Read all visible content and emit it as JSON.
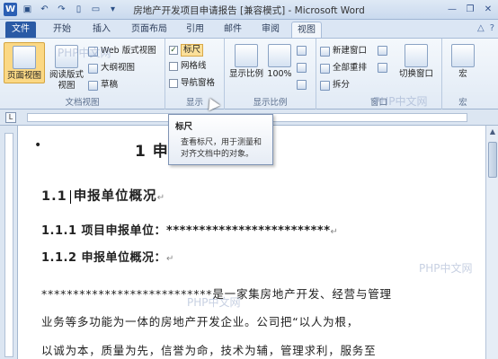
{
  "window": {
    "title": "房地产开发项目申请报告 [兼容模式] - Microsoft Word",
    "qat_icons": [
      "word-logo",
      "save-icon",
      "undo-icon",
      "redo-icon",
      "new-doc-icon",
      "open-icon",
      "customize-qat-icon"
    ],
    "controls": [
      "minimize-icon",
      "restore-icon",
      "close-icon"
    ]
  },
  "tabs": [
    {
      "label": "文件",
      "type": "file"
    },
    {
      "label": "开始"
    },
    {
      "label": "插入"
    },
    {
      "label": "页面布局"
    },
    {
      "label": "引用"
    },
    {
      "label": "邮件"
    },
    {
      "label": "审阅"
    },
    {
      "label": "视图",
      "active": true
    }
  ],
  "ribbon": {
    "views_group": {
      "label": "文档视图",
      "print_layout": "页面视图",
      "read_mode": "阅读版式\n视图",
      "web_layout": "Web 版式视图",
      "outline": "大纲视图",
      "draft": "草稿"
    },
    "show_group": {
      "label": "显示",
      "ruler": "标尺",
      "ruler_checked": true,
      "gridlines": "网格线",
      "gridlines_checked": false,
      "nav_pane": "导航窗格",
      "nav_pane_checked": false
    },
    "zoom_group": {
      "label": "显示比例",
      "zoom": "显示比例",
      "hundred": "100%"
    },
    "window_group": {
      "label": "窗口",
      "new_window": "新建窗口",
      "arrange_all": "全部重排",
      "split": "拆分",
      "switch_windows": "切换窗口"
    },
    "macros_group": {
      "label": "宏",
      "macros": "宏"
    }
  },
  "tooltip": {
    "title": "标尺",
    "body_line1": "查看标尺，用于测量和",
    "body_line2": "对齐文档中的对象。"
  },
  "document": {
    "title": "1  申报单位概况",
    "title_visible_suffix": "目概况",
    "h1_number": "1.1",
    "h1_text": "申报单位概况",
    "h2a": "1.1.1 项目申报单位：*************************",
    "h2b": "1.1.2 申报单位概况：",
    "para_line1": "***************************是一家集房地产开发、经营与管理",
    "para_line2": "业务等多功能为一体的房地产开发企业。公司把“以人为根，",
    "para_line3": "以诚为本，质量为先，信誉为命，技术为辅，管理求利，服务至"
  },
  "watermarks": [
    "PHP中文网",
    "PHP中文网",
    "PHP中文网",
    "PHP中文网"
  ]
}
